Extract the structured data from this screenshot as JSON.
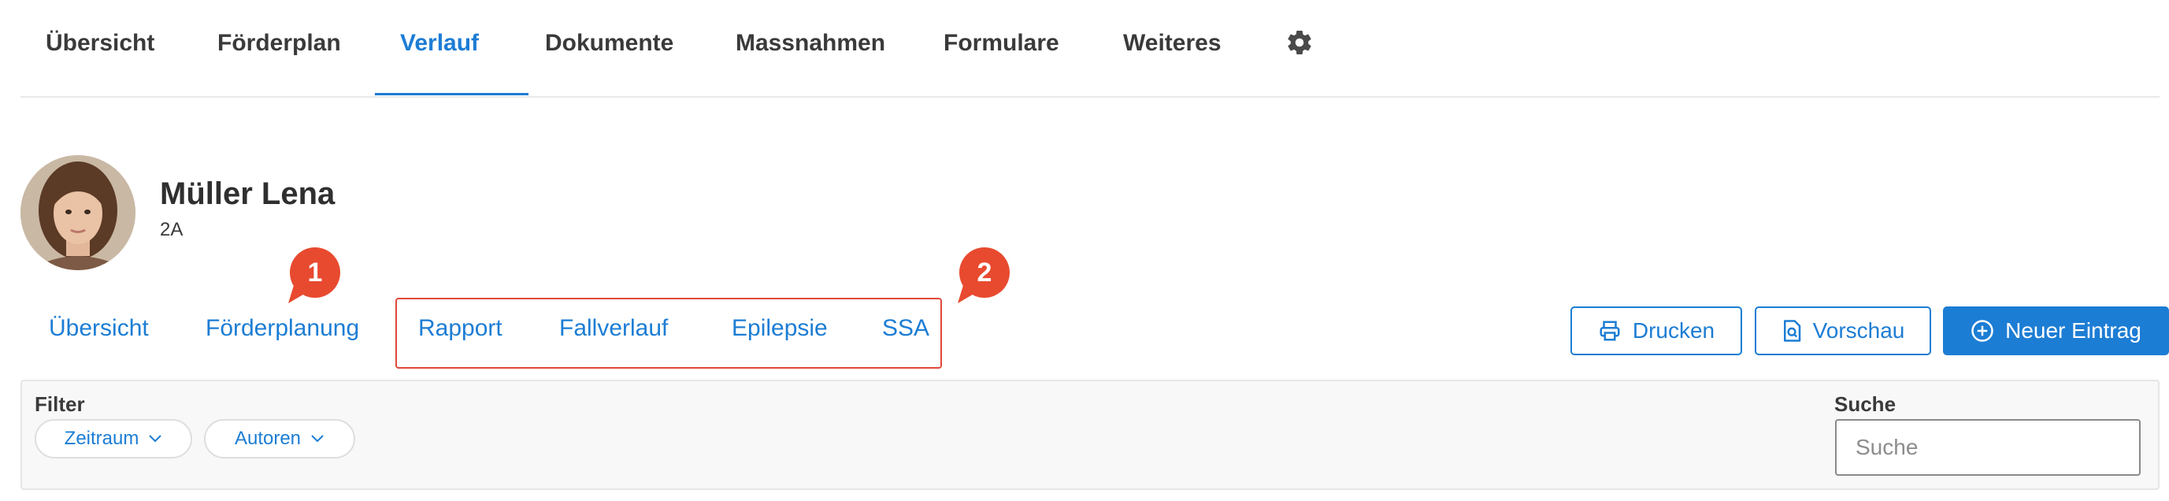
{
  "top_nav": {
    "tabs": [
      {
        "label": "Übersicht"
      },
      {
        "label": "Förderplan"
      },
      {
        "label": "Verlauf"
      },
      {
        "label": "Dokumente"
      },
      {
        "label": "Massnahmen"
      },
      {
        "label": "Formulare"
      },
      {
        "label": "Weiteres"
      }
    ],
    "active_tab": "Verlauf",
    "settings_icon": "gear-icon"
  },
  "student": {
    "name": "Müller Lena",
    "class": "2A"
  },
  "sub_nav": {
    "tabs": [
      {
        "label": "Übersicht"
      },
      {
        "label": "Förderplanung"
      },
      {
        "label": "Rapport"
      },
      {
        "label": "Fallverlauf"
      },
      {
        "label": "Epilepsie"
      },
      {
        "label": "SSA"
      }
    ]
  },
  "callouts": [
    "1",
    "2"
  ],
  "actions": {
    "print": {
      "label": "Drucken",
      "icon": "printer-icon"
    },
    "preview": {
      "label": "Vorschau",
      "icon": "document-search-icon"
    },
    "new_entry": {
      "label": "Neuer Eintrag",
      "icon": "plus-circle-icon"
    }
  },
  "filter": {
    "label": "Filter",
    "period": "Zeitraum",
    "authors": "Autoren"
  },
  "search": {
    "label": "Suche",
    "placeholder": "Suche"
  },
  "colors": {
    "accent": "#1c7dd4",
    "callout": "#e84a2f",
    "highlight_border": "#e0483a"
  }
}
